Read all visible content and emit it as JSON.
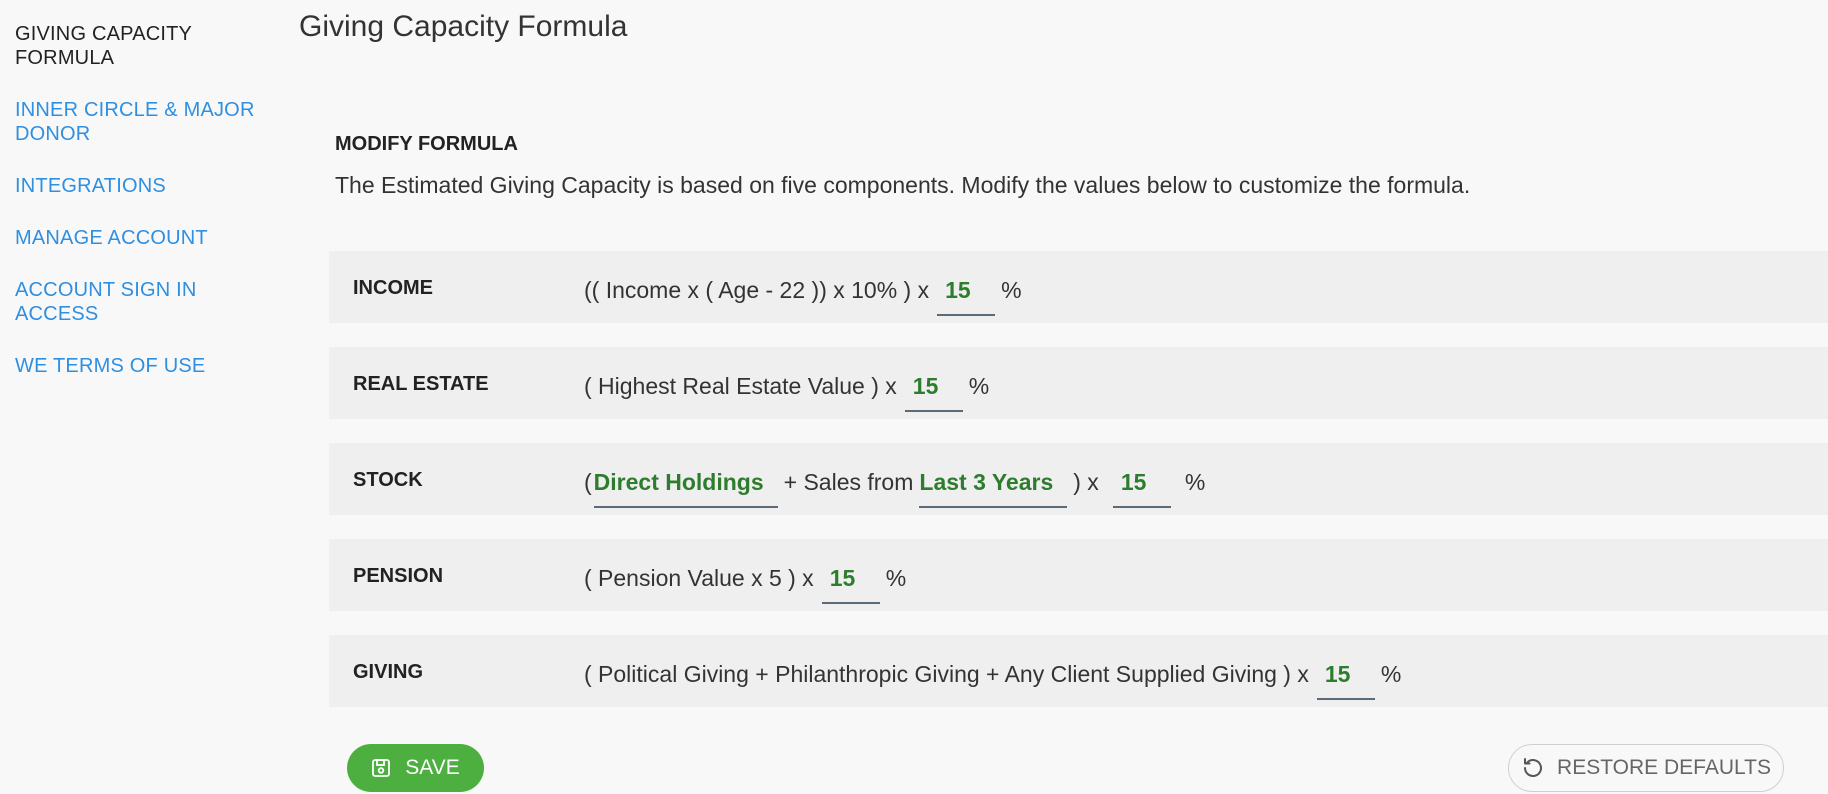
{
  "sidebar": {
    "items": [
      {
        "label": "GIVING CAPACITY FORMULA",
        "line1": "GIVING CAPACITY",
        "line2": "FORMULA",
        "active": true
      },
      {
        "label": "INNER CIRCLE & MAJOR DONOR",
        "line1": "INNER CIRCLE & MAJOR",
        "line2": "DONOR",
        "active": false
      },
      {
        "label": "INTEGRATIONS",
        "line1": "INTEGRATIONS",
        "line2": "",
        "active": false
      },
      {
        "label": "MANAGE ACCOUNT",
        "line1": "MANAGE ACCOUNT",
        "line2": "",
        "active": false
      },
      {
        "label": "ACCOUNT SIGN IN ACCESS",
        "line1": "ACCOUNT SIGN IN",
        "line2": "ACCESS",
        "active": false
      },
      {
        "label": "WE TERMS OF USE",
        "line1": "WE TERMS OF USE",
        "line2": "",
        "active": false
      }
    ]
  },
  "page": {
    "title": "Giving Capacity Formula",
    "section_heading": "MODIFY FORMULA",
    "description": "The Estimated Giving Capacity is based on five components. Modify the values below to customize the formula."
  },
  "rows": {
    "income": {
      "label": "INCOME",
      "prefix": "(( Income x ( Age - 22 )) x 10% ) x",
      "value": "15",
      "suffix": "%"
    },
    "real_estate": {
      "label": "REAL ESTATE",
      "prefix": "( Highest Real Estate Value ) x",
      "value": "15",
      "suffix": "%"
    },
    "stock": {
      "label": "STOCK",
      "open": "(",
      "holdings_value": "Direct Holdings",
      "middle": "+ Sales from",
      "period_value": "Last 3 Years",
      "close": ") x",
      "value": "15",
      "suffix": "%"
    },
    "pension": {
      "label": "PENSION",
      "prefix": "( Pension Value x 5 ) x",
      "value": "15",
      "suffix": "%"
    },
    "giving": {
      "label": "GIVING",
      "prefix": "( Political Giving + Philanthropic Giving + Any Client Supplied Giving ) x",
      "value": "15",
      "suffix": "%"
    }
  },
  "actions": {
    "save_label": "SAVE",
    "save_icon": "save-icon",
    "restore_label": "RESTORE DEFAULTS",
    "restore_icon": "restore-icon"
  },
  "colors": {
    "accent_link": "#2f8fe0",
    "value_green": "#2e7d2e",
    "save_button": "#4caf3f"
  }
}
